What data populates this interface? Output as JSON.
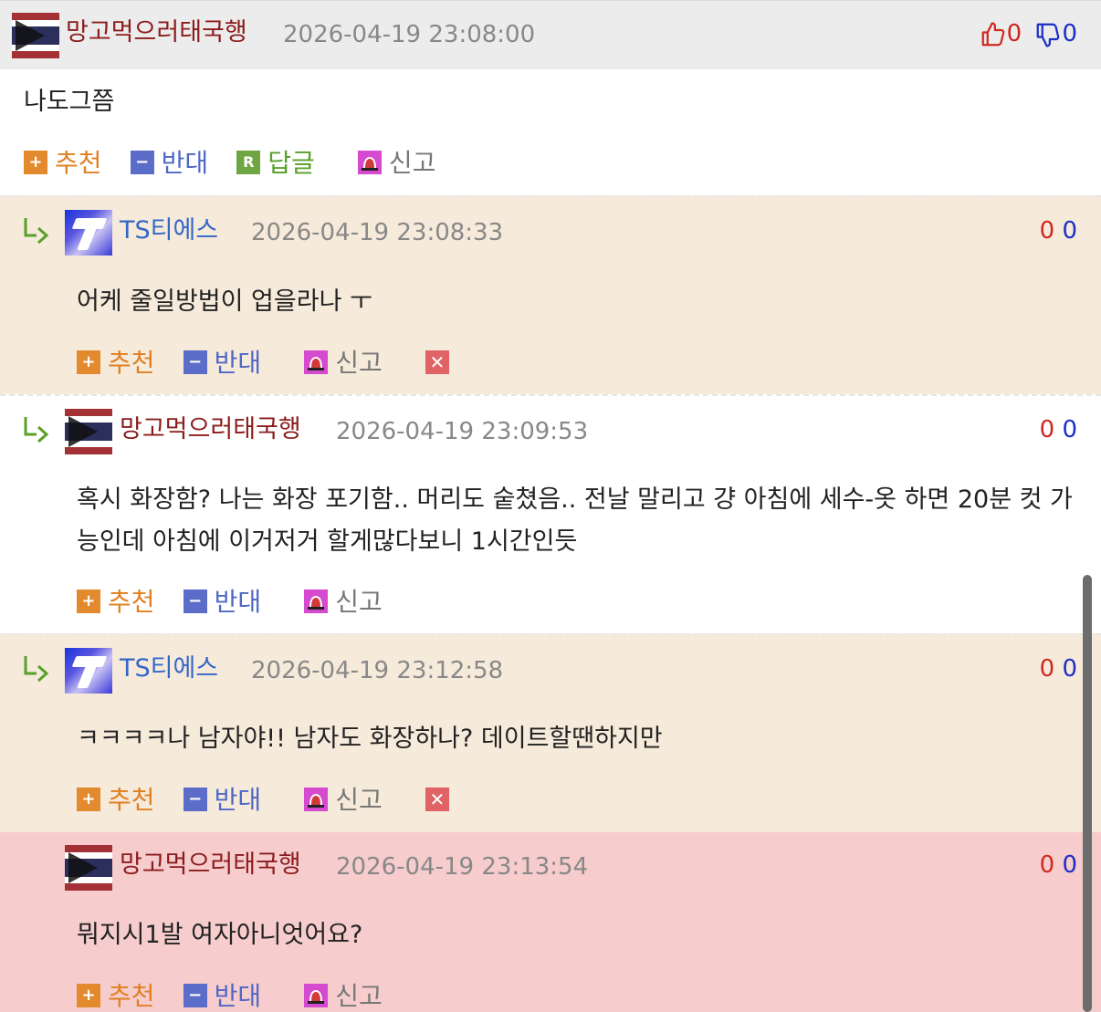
{
  "top_comment": {
    "author": "망고먹으러태국행",
    "avatar": "thailand-flag-avatar",
    "date": "2026-04-19 23:08:00",
    "likes": "0",
    "dislikes": "0",
    "body": "나도그쯤"
  },
  "replies": [
    {
      "author": "TS티에스",
      "avatar": "ts-logo-avatar",
      "date": "2026-04-19 23:08:33",
      "likes": "0",
      "dislikes": "0",
      "body": "어케 줄일방법이 업을라나 ㅜ"
    },
    {
      "author": "망고먹으러태국행",
      "avatar": "thailand-flag-avatar",
      "date": "2026-04-19 23:09:53",
      "likes": "0",
      "dislikes": "0",
      "body": "혹시 화장함? 나는 화장 포기함.. 머리도 숱쳤음.. 전날 말리고 걍 아침에 세수-옷 하면 20분 컷 가능인데 아침에 이거저거 할게많다보니 1시간인듯"
    },
    {
      "author": "TS티에스",
      "avatar": "ts-logo-avatar",
      "date": "2026-04-19 23:12:58",
      "likes": "0",
      "dislikes": "0",
      "body": "ㅋㅋㅋㅋ나 남자야!! 남자도 화장하나? 데이트할땐하지만"
    },
    {
      "author": "망고먹으러태국행",
      "avatar": "thailand-flag-avatar",
      "date": "2026-04-19 23:13:54",
      "likes": "0",
      "dislikes": "0",
      "body": "뭐지시1발 여자아니엇어요?"
    }
  ],
  "actions": {
    "recommend_label": "추천",
    "oppose_label": "반대",
    "reply_label": "답글",
    "report_label": "신고",
    "plus_glyph": "+",
    "minus_glyph": "−",
    "reply_glyph": "R",
    "delete_glyph": "✕"
  },
  "colors": {
    "header_bg": "#ececec",
    "reply_bg": "#f6eadb",
    "highlight_bg": "#f6cccd",
    "nick_red": "#8b1c1c",
    "nick_blue": "#3567c6",
    "like_red": "#d0281f",
    "dislike_blue": "#1c2ec6"
  }
}
